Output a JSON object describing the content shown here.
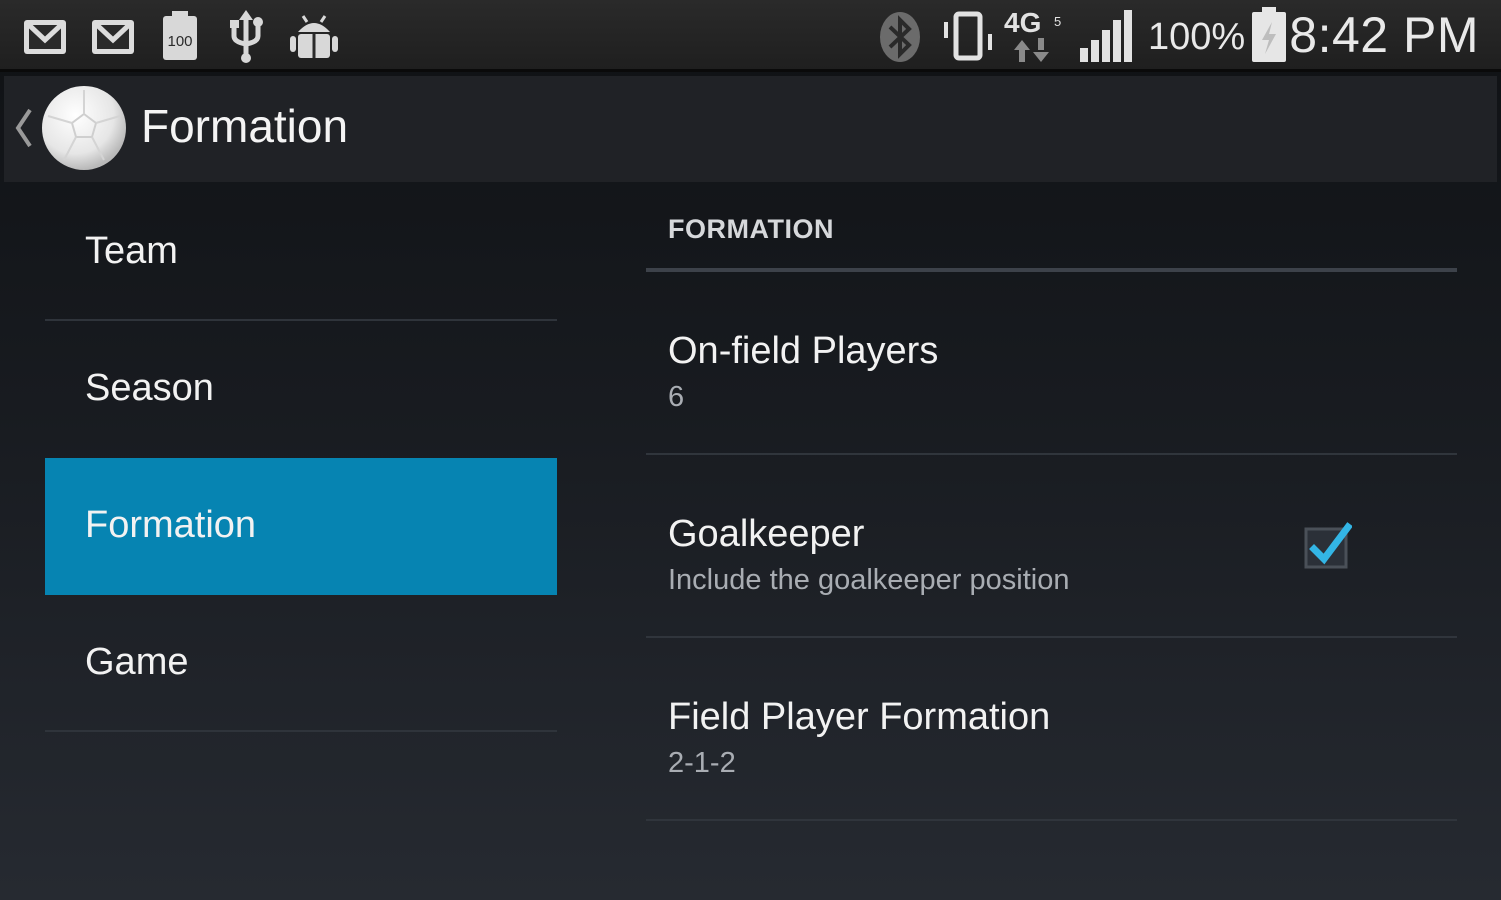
{
  "status_bar": {
    "time": "8:42 PM",
    "battery_percent": "100%",
    "network": "4G",
    "icons": [
      "gmail-icon",
      "gmail-icon",
      "battery-100-notification-icon",
      "usb-icon",
      "android-debug-icon",
      "bluetooth-icon",
      "vibrate-icon",
      "4g-data-icon",
      "signal-strength-icon",
      "battery-charging-icon"
    ]
  },
  "action_bar": {
    "title": "Formation",
    "icons": [
      "up-chevron-icon",
      "soccer-ball-logo"
    ]
  },
  "headers": [
    {
      "label": "Team",
      "selected": false
    },
    {
      "label": "Season",
      "selected": false
    },
    {
      "label": "Formation",
      "selected": true
    },
    {
      "label": "Game",
      "selected": false
    }
  ],
  "preferences": {
    "category": "FORMATION",
    "items": [
      {
        "title": "On-field Players",
        "summary": "6"
      },
      {
        "title": "Goalkeeper",
        "summary": "Include the goalkeeper position",
        "checked": true
      },
      {
        "title": "Field Player Formation",
        "summary": "2-1-2"
      }
    ]
  },
  "colors": {
    "selected_header": "#0684b2",
    "checkbox_tick": "#33b5e5",
    "action_bar": "#202226"
  }
}
